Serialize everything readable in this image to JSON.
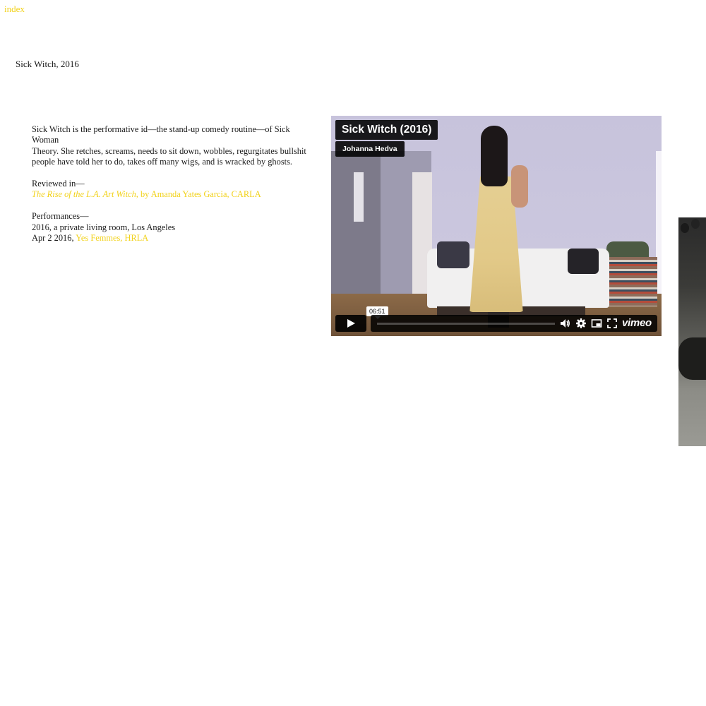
{
  "nav": {
    "index_label": "index"
  },
  "page": {
    "title": "Sick Witch, 2016"
  },
  "description": {
    "line1": "Sick Witch is the performative id—the stand-up comedy routine—of Sick Woman",
    "line2": "Theory. She retches, screams, needs to sit down, wobbles, regurgitates bullshit",
    "line3": "people have told her to do, takes off many wigs, and is wracked by ghosts."
  },
  "reviewed": {
    "heading": "Reviewed in—",
    "link_title": "The Rise of the L.A. Art Witch",
    "link_rest": ", by Amanda Yates Garcia, CARLA"
  },
  "performances": {
    "heading": "Performances—",
    "item1": "2016, a private living room, Los Angeles",
    "item2_date": "Apr 2 2016, ",
    "item2_link": "Yes Femmes, HRLA"
  },
  "video": {
    "title": "Sick Witch (2016)",
    "author": "Johanna Hedva",
    "time_label": "06:51",
    "progress": 0,
    "brand": "vimeo",
    "icons": [
      "play-icon",
      "volume-icon",
      "settings-icon",
      "picture-in-picture-icon",
      "fullscreen-icon"
    ]
  },
  "colors": {
    "link": "#f2d21b",
    "text": "#1a1a1a",
    "background": "#ffffff"
  }
}
